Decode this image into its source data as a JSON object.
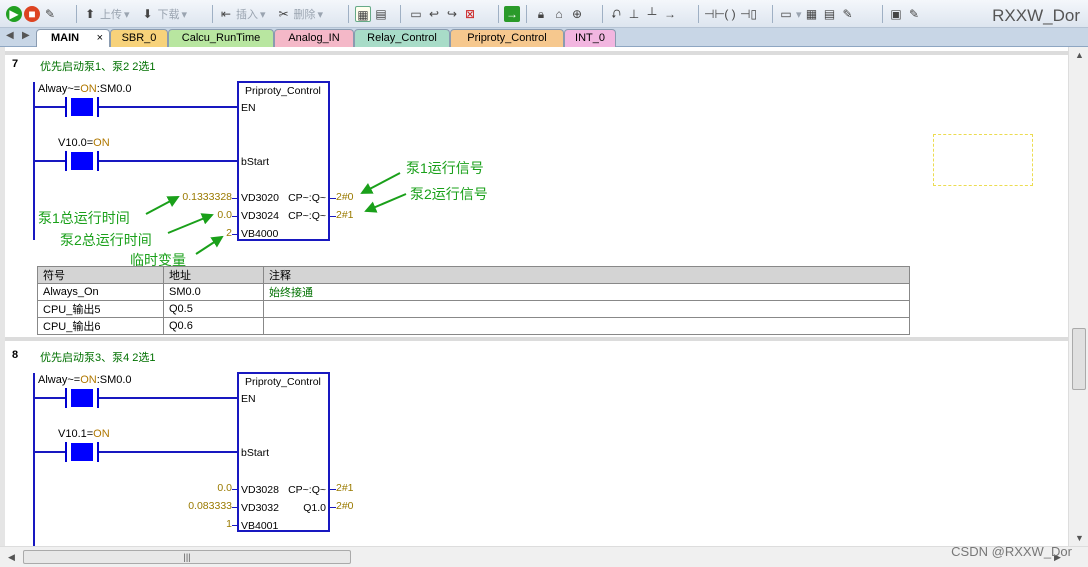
{
  "toolbar": {
    "upload_label": "上传",
    "download_label": "下载",
    "insert_label": "插入",
    "delete_label": "删除",
    "title_right": "RXXW_Dor"
  },
  "tabs": [
    {
      "label": "MAIN",
      "color": "#ffffff"
    },
    {
      "label": "SBR_0",
      "color": "#f7d27a"
    },
    {
      "label": "Calcu_RunTime",
      "color": "#b8e6a0"
    },
    {
      "label": "Analog_IN",
      "color": "#f4b8c8"
    },
    {
      "label": "Relay_Control",
      "color": "#a8dcc8"
    },
    {
      "label": "Priproty_Control",
      "color": "#f6c88e"
    },
    {
      "label": "INT_0",
      "color": "#f2b6e0"
    }
  ],
  "tab_close": "×",
  "network7": {
    "number": "7",
    "comment": "优先启动泵1、泵2 2选1",
    "contact1_name": "Alway~=",
    "contact1_state": "ON",
    "contact1_addr": ":SM0.0",
    "contact2_name": "V10.0=",
    "contact2_state": "ON",
    "box_title": "Priproty_Control",
    "pin_en": "EN",
    "pin_bstart": "bStart",
    "in1_val": "0.1333328",
    "in1_addr": "VD3020",
    "out1_label": "CP~:Q~",
    "out1_val": "2#0",
    "in2_val": "0.0",
    "in2_addr": "VD3024",
    "out2_label": "CP~:Q~",
    "out2_val": "2#1",
    "in3_val": "2",
    "in3_addr": "VB4000"
  },
  "annotations": {
    "pump1_signal": "泵1运行信号",
    "pump2_signal": "泵2运行信号",
    "pump1_time": "泵1总运行时间",
    "pump2_time": "泵2总运行时间",
    "temp_var": "临时变量"
  },
  "symbol_table": {
    "headers": [
      "符号",
      "地址",
      "注释"
    ],
    "rows": [
      [
        "Always_On",
        "SM0.0",
        "始终接通"
      ],
      [
        "CPU_输出5",
        "Q0.5",
        ""
      ],
      [
        "CPU_输出6",
        "Q0.6",
        ""
      ]
    ]
  },
  "network8": {
    "number": "8",
    "comment": "优先启动泵3、泵4 2选1",
    "contact1_name": "Alway~=",
    "contact1_state": "ON",
    "contact1_addr": ":SM0.0",
    "contact2_name": "V10.1=",
    "contact2_state": "ON",
    "box_title": "Priproty_Control",
    "pin_en": "EN",
    "pin_bstart": "bStart",
    "in1_val": "0.0",
    "in1_addr": "VD3028",
    "out1_label": "CP~:Q~",
    "out1_val": "2#1",
    "in2_val": "0.083333",
    "in2_addr": "VD3032",
    "out2_label": "Q1.0",
    "out2_val": "2#0",
    "in3_val": "1",
    "in3_addr": "VB4001"
  },
  "hscroll_grip": "|||",
  "watermark": "CSDN @RXXW_Dor",
  "colors": {
    "rung": "#1818c0",
    "contact_fill": "#0000ff",
    "comment": "#007000",
    "annotation": "#1aa01a",
    "value": "#9a7a00"
  }
}
